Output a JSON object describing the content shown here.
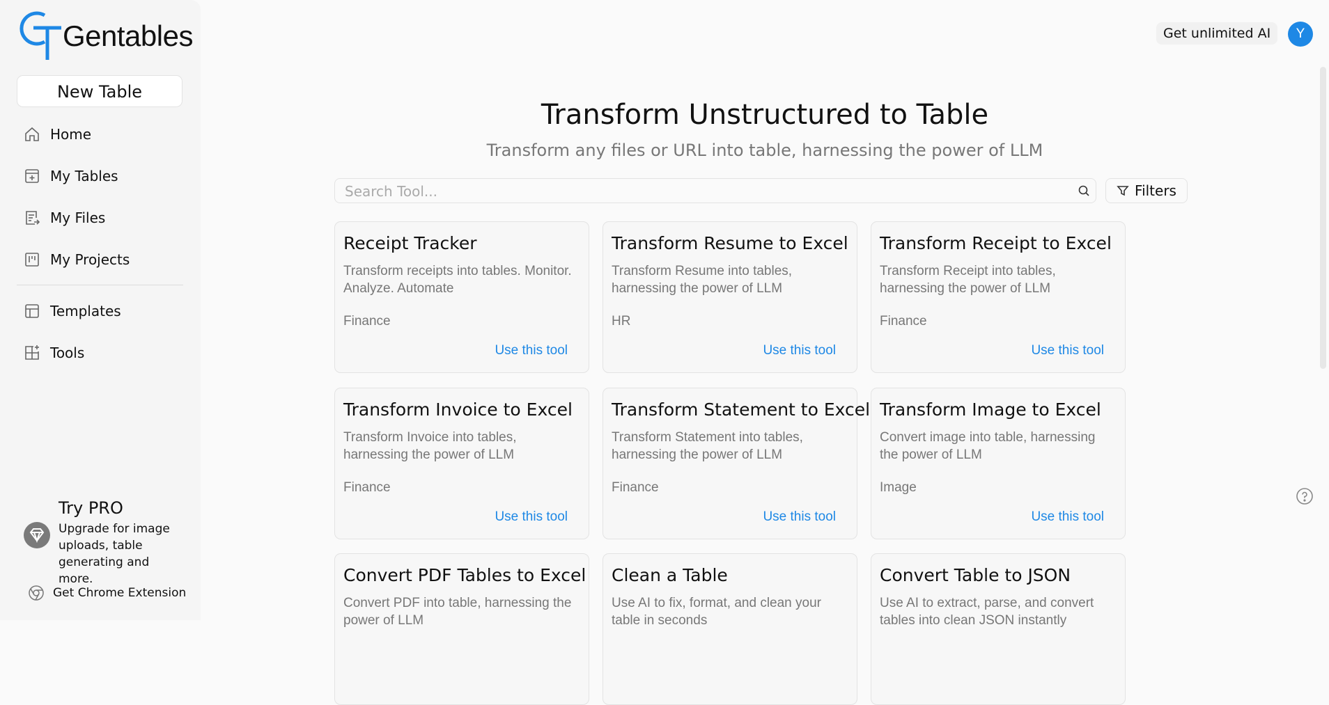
{
  "brand": {
    "logo_text": "Gentables",
    "accent": "#1e88e5"
  },
  "sidebar": {
    "new_table": "New Table",
    "nav": [
      {
        "label": "Home",
        "icon": "home-icon"
      },
      {
        "label": "My Tables",
        "icon": "table-plus-icon"
      },
      {
        "label": "My Files",
        "icon": "file-export-icon"
      },
      {
        "label": "My Projects",
        "icon": "kanban-icon"
      }
    ],
    "nav2": [
      {
        "label": "Templates",
        "icon": "layout-icon"
      },
      {
        "label": "Tools",
        "icon": "grid-plus-icon"
      }
    ],
    "pro": {
      "title": "Try PRO",
      "description": "Upgrade for image uploads, table generating and more."
    },
    "chrome_extension": "Get Chrome Extension"
  },
  "header": {
    "get_ai": "Get unlimited AI",
    "avatar_initial": "Y"
  },
  "main": {
    "title": "Transform Unstructured to Table",
    "subtitle": "Transform any files or URL into table, harnessing the power of LLM",
    "search_placeholder": "Search Tool...",
    "filters": "Filters",
    "use_label": "Use this tool",
    "cards": [
      {
        "title": "Receipt Tracker",
        "description": "Transform receipts into tables. Monitor. Analyze. Automate",
        "category": "Finance"
      },
      {
        "title": "Transform Resume to Excel",
        "description": "Transform Resume into tables, harnessing the power of LLM",
        "category": "HR"
      },
      {
        "title": "Transform Receipt to Excel",
        "description": "Transform Receipt into tables, harnessing the power of LLM",
        "category": "Finance"
      },
      {
        "title": "Transform Invoice to Excel",
        "description": "Transform Invoice into tables, harnessing the power of LLM",
        "category": "Finance"
      },
      {
        "title": "Transform Statement to Excel",
        "description": "Transform Statement into tables, harnessing the power of LLM",
        "category": "Finance"
      },
      {
        "title": "Transform Image to Excel",
        "description": "Convert image into table, harnessing the power of LLM",
        "category": "Image"
      },
      {
        "title": "Convert PDF Tables to Excel",
        "description": "Convert PDF into table, harnessing the power of LLM",
        "category": ""
      },
      {
        "title": "Clean a Table",
        "description": "Use AI to fix, format, and clean your table in seconds",
        "category": ""
      },
      {
        "title": "Convert Table to JSON",
        "description": "Use AI to extract, parse, and convert tables into clean JSON instantly",
        "category": ""
      }
    ]
  }
}
